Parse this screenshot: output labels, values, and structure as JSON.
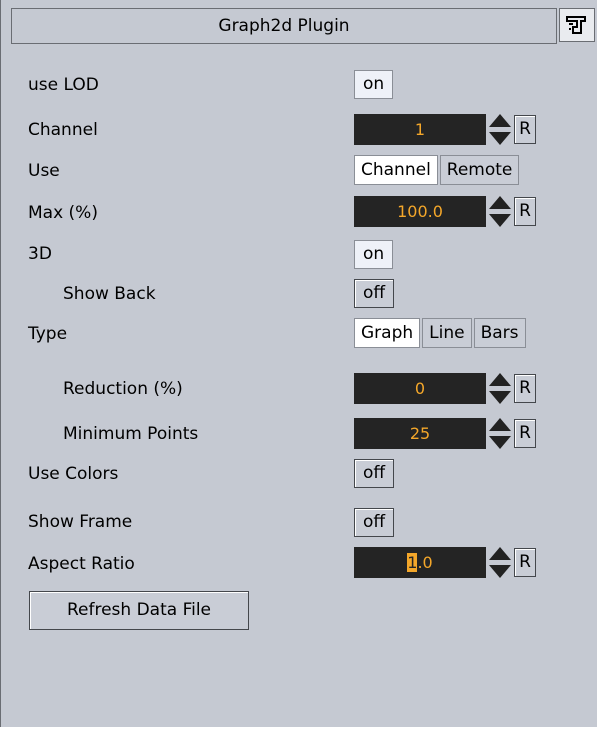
{
  "title": "Graph2d Plugin",
  "title_icon": "plugin-icon",
  "rows": {
    "use_lod": {
      "label": "use LOD",
      "value": "on"
    },
    "channel": {
      "label": "Channel",
      "value": "1",
      "reset": "R"
    },
    "use": {
      "label": "Use",
      "options": [
        "Channel",
        "Remote"
      ],
      "selected": "Channel"
    },
    "max": {
      "label": "Max (%)",
      "value": "100.0",
      "reset": "R"
    },
    "three_d": {
      "label": "3D",
      "value": "on"
    },
    "show_back": {
      "label": "Show Back",
      "value": "off"
    },
    "type": {
      "label": "Type",
      "options": [
        "Graph",
        "Line",
        "Bars"
      ],
      "selected": "Graph"
    },
    "reduction": {
      "label": "Reduction (%)",
      "value": "0",
      "reset": "R"
    },
    "min_points": {
      "label": "Minimum Points",
      "value": "25",
      "reset": "R"
    },
    "use_colors": {
      "label": "Use Colors",
      "value": "off"
    },
    "show_frame": {
      "label": "Show Frame",
      "value": "off"
    },
    "aspect": {
      "label": "Aspect Ratio",
      "value_sel": "1",
      "value_rest": ".0",
      "reset": "R"
    }
  },
  "refresh_label": "Refresh Data File",
  "colors": {
    "panel": "#c5c9d2",
    "field_bg": "#242424",
    "field_text": "#f4a72a"
  }
}
